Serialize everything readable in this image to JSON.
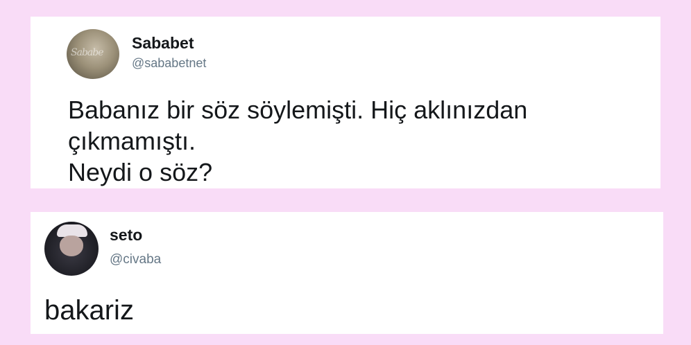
{
  "tweets": [
    {
      "author_name": "Sababet",
      "author_handle": "@sababetnet",
      "text": "Babanız bir söz söylemişti. Hiç aklınızdan\nçıkmamıştı.\nNeydi o söz?",
      "avatar": "sababet-avatar"
    },
    {
      "author_name": "seto",
      "author_handle": "@civaba",
      "text": "bakariz",
      "avatar": "seto-avatar"
    }
  ],
  "colors": {
    "background": "#f9dcf7",
    "card": "#ffffff",
    "name": "#14171a",
    "handle": "#657786"
  }
}
